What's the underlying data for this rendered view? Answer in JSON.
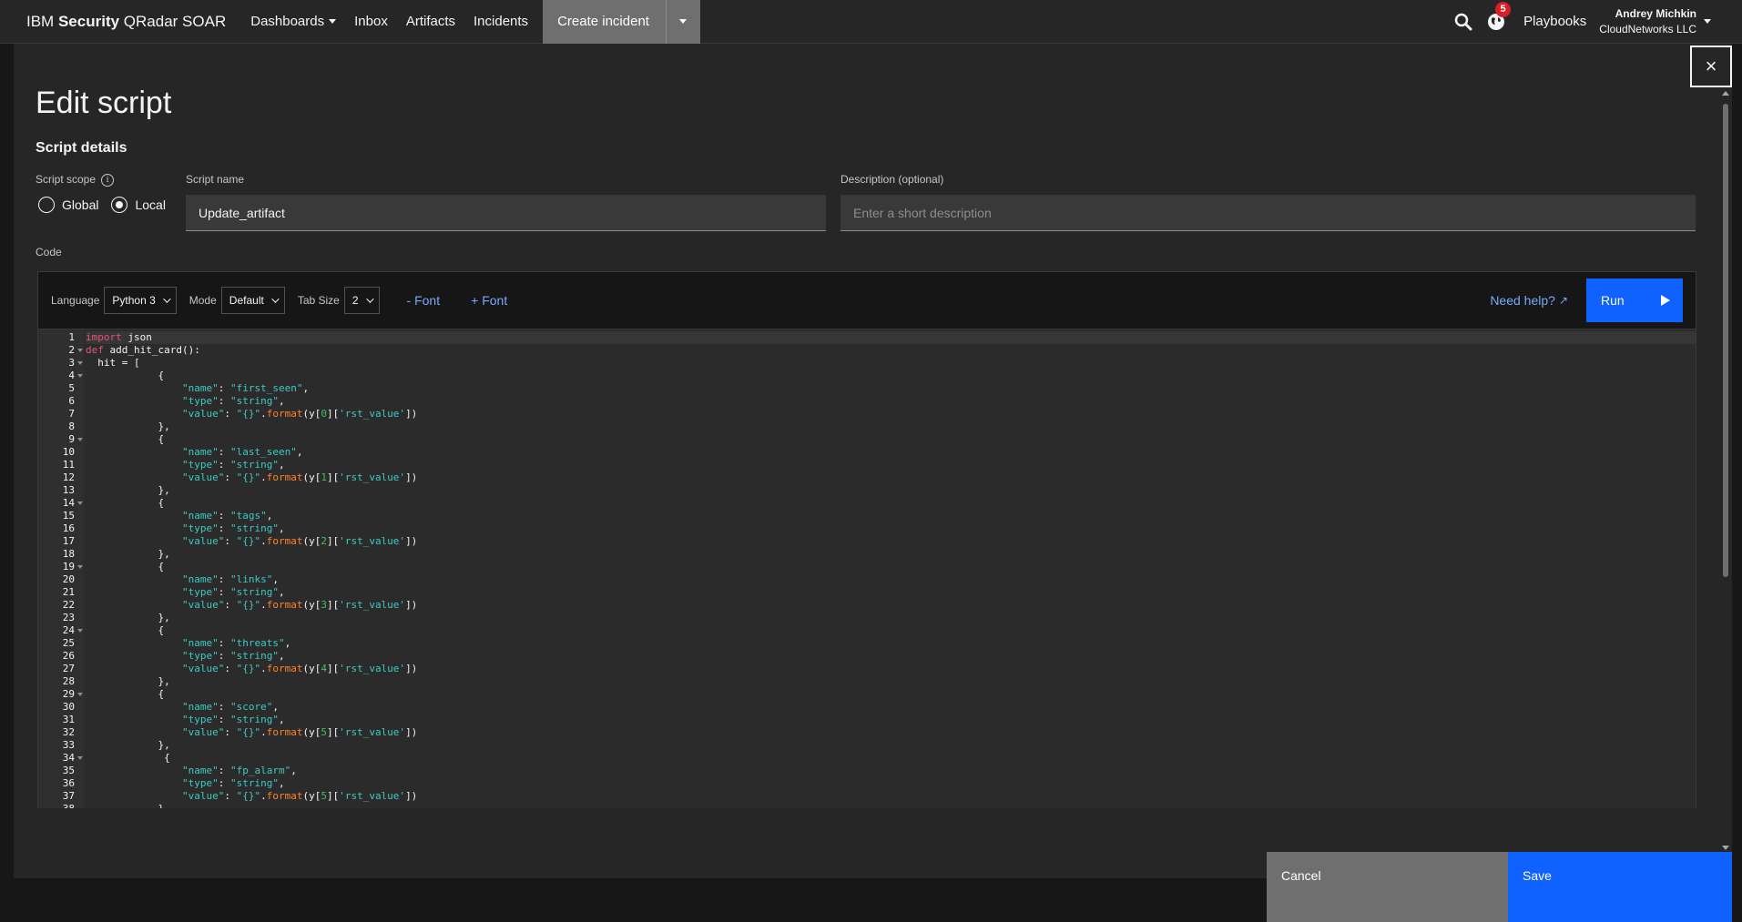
{
  "nav": {
    "brand_prefix": "IBM",
    "brand_bold": "Security",
    "brand_suffix": "QRadar SOAR",
    "items": [
      "Dashboards",
      "Inbox",
      "Artifacts",
      "Incidents"
    ],
    "create_label": "Create incident",
    "notification_count": "5",
    "playbooks_label": "Playbooks",
    "user_name": "Andrey Michkin",
    "org_name": "CloudNetworks LLC"
  },
  "modal": {
    "title": "Edit script",
    "section_title": "Script details",
    "close_label": "×"
  },
  "form": {
    "scope_label": "Script scope",
    "scope_options": [
      "Global",
      "Local"
    ],
    "scope_selected": "Local",
    "name_label": "Script name",
    "name_value": "Update_artifact",
    "description_label": "Description (optional)",
    "description_placeholder": "Enter a short description",
    "code_label": "Code"
  },
  "editor": {
    "language_label": "Language",
    "language_value": "Python 3",
    "mode_label": "Mode",
    "mode_value": "Default",
    "tab_size_label": "Tab Size",
    "tab_size_value": "2",
    "font_decrease": "- Font",
    "font_increase": "+ Font",
    "help_label": "Need help?",
    "run_label": "Run"
  },
  "code_lines": [
    [
      [
        "kw",
        "import"
      ],
      [
        "t",
        " json"
      ]
    ],
    [
      [
        "kw",
        "def"
      ],
      [
        "t",
        " add_hit_card():"
      ]
    ],
    [
      [
        "t",
        "  hit = ["
      ]
    ],
    [
      [
        "t",
        "            {"
      ]
    ],
    [
      [
        "t",
        "                "
      ],
      [
        "str",
        "\"name\""
      ],
      [
        "t",
        ": "
      ],
      [
        "str",
        "\"first_seen\""
      ],
      [
        "t",
        ","
      ]
    ],
    [
      [
        "t",
        "                "
      ],
      [
        "str",
        "\"type\""
      ],
      [
        "t",
        ": "
      ],
      [
        "str",
        "\"string\""
      ],
      [
        "t",
        ","
      ]
    ],
    [
      [
        "t",
        "                "
      ],
      [
        "str",
        "\"value\""
      ],
      [
        "t",
        ": "
      ],
      [
        "str",
        "\"{}\""
      ],
      [
        "t",
        "."
      ],
      [
        "fn",
        "format"
      ],
      [
        "t",
        "(y["
      ],
      [
        "num",
        "0"
      ],
      [
        "t",
        "]["
      ],
      [
        "str",
        "'rst_value'"
      ],
      [
        "t",
        "])"
      ]
    ],
    [
      [
        "t",
        "            },"
      ]
    ],
    [
      [
        "t",
        "            {"
      ]
    ],
    [
      [
        "t",
        "                "
      ],
      [
        "str",
        "\"name\""
      ],
      [
        "t",
        ": "
      ],
      [
        "str",
        "\"last_seen\""
      ],
      [
        "t",
        ","
      ]
    ],
    [
      [
        "t",
        "                "
      ],
      [
        "str",
        "\"type\""
      ],
      [
        "t",
        ": "
      ],
      [
        "str",
        "\"string\""
      ],
      [
        "t",
        ","
      ]
    ],
    [
      [
        "t",
        "                "
      ],
      [
        "str",
        "\"value\""
      ],
      [
        "t",
        ": "
      ],
      [
        "str",
        "\"{}\""
      ],
      [
        "t",
        "."
      ],
      [
        "fn",
        "format"
      ],
      [
        "t",
        "(y["
      ],
      [
        "num",
        "1"
      ],
      [
        "t",
        "]["
      ],
      [
        "str",
        "'rst_value'"
      ],
      [
        "t",
        "])"
      ]
    ],
    [
      [
        "t",
        "            },"
      ]
    ],
    [
      [
        "t",
        "            {"
      ]
    ],
    [
      [
        "t",
        "                "
      ],
      [
        "str",
        "\"name\""
      ],
      [
        "t",
        ": "
      ],
      [
        "str",
        "\"tags\""
      ],
      [
        "t",
        ","
      ]
    ],
    [
      [
        "t",
        "                "
      ],
      [
        "str",
        "\"type\""
      ],
      [
        "t",
        ": "
      ],
      [
        "str",
        "\"string\""
      ],
      [
        "t",
        ","
      ]
    ],
    [
      [
        "t",
        "                "
      ],
      [
        "str",
        "\"value\""
      ],
      [
        "t",
        ": "
      ],
      [
        "str",
        "\"{}\""
      ],
      [
        "t",
        "."
      ],
      [
        "fn",
        "format"
      ],
      [
        "t",
        "(y["
      ],
      [
        "num",
        "2"
      ],
      [
        "t",
        "]["
      ],
      [
        "str",
        "'rst_value'"
      ],
      [
        "t",
        "])"
      ]
    ],
    [
      [
        "t",
        "            },"
      ]
    ],
    [
      [
        "t",
        "            {"
      ]
    ],
    [
      [
        "t",
        "                "
      ],
      [
        "str",
        "\"name\""
      ],
      [
        "t",
        ": "
      ],
      [
        "str",
        "\"links\""
      ],
      [
        "t",
        ","
      ]
    ],
    [
      [
        "t",
        "                "
      ],
      [
        "str",
        "\"type\""
      ],
      [
        "t",
        ": "
      ],
      [
        "str",
        "\"string\""
      ],
      [
        "t",
        ","
      ]
    ],
    [
      [
        "t",
        "                "
      ],
      [
        "str",
        "\"value\""
      ],
      [
        "t",
        ": "
      ],
      [
        "str",
        "\"{}\""
      ],
      [
        "t",
        "."
      ],
      [
        "fn",
        "format"
      ],
      [
        "t",
        "(y["
      ],
      [
        "num",
        "3"
      ],
      [
        "t",
        "]["
      ],
      [
        "str",
        "'rst_value'"
      ],
      [
        "t",
        "])"
      ]
    ],
    [
      [
        "t",
        "            },"
      ]
    ],
    [
      [
        "t",
        "            {"
      ]
    ],
    [
      [
        "t",
        "                "
      ],
      [
        "str",
        "\"name\""
      ],
      [
        "t",
        ": "
      ],
      [
        "str",
        "\"threats\""
      ],
      [
        "t",
        ","
      ]
    ],
    [
      [
        "t",
        "                "
      ],
      [
        "str",
        "\"type\""
      ],
      [
        "t",
        ": "
      ],
      [
        "str",
        "\"string\""
      ],
      [
        "t",
        ","
      ]
    ],
    [
      [
        "t",
        "                "
      ],
      [
        "str",
        "\"value\""
      ],
      [
        "t",
        ": "
      ],
      [
        "str",
        "\"{}\""
      ],
      [
        "t",
        "."
      ],
      [
        "fn",
        "format"
      ],
      [
        "t",
        "(y["
      ],
      [
        "num",
        "4"
      ],
      [
        "t",
        "]["
      ],
      [
        "str",
        "'rst_value'"
      ],
      [
        "t",
        "])"
      ]
    ],
    [
      [
        "t",
        "            },"
      ]
    ],
    [
      [
        "t",
        "            {"
      ]
    ],
    [
      [
        "t",
        "                "
      ],
      [
        "str",
        "\"name\""
      ],
      [
        "t",
        ": "
      ],
      [
        "str",
        "\"score\""
      ],
      [
        "t",
        ","
      ]
    ],
    [
      [
        "t",
        "                "
      ],
      [
        "str",
        "\"type\""
      ],
      [
        "t",
        ": "
      ],
      [
        "str",
        "\"string\""
      ],
      [
        "t",
        ","
      ]
    ],
    [
      [
        "t",
        "                "
      ],
      [
        "str",
        "\"value\""
      ],
      [
        "t",
        ": "
      ],
      [
        "str",
        "\"{}\""
      ],
      [
        "t",
        "."
      ],
      [
        "fn",
        "format"
      ],
      [
        "t",
        "(y["
      ],
      [
        "num",
        "5"
      ],
      [
        "t",
        "]["
      ],
      [
        "str",
        "'rst_value'"
      ],
      [
        "t",
        "])"
      ]
    ],
    [
      [
        "t",
        "            },"
      ]
    ],
    [
      [
        "t",
        "             {"
      ]
    ],
    [
      [
        "t",
        "                "
      ],
      [
        "str",
        "\"name\""
      ],
      [
        "t",
        ": "
      ],
      [
        "str",
        "\"fp_alarm\""
      ],
      [
        "t",
        ","
      ]
    ],
    [
      [
        "t",
        "                "
      ],
      [
        "str",
        "\"type\""
      ],
      [
        "t",
        ": "
      ],
      [
        "str",
        "\"string\""
      ],
      [
        "t",
        ","
      ]
    ],
    [
      [
        "t",
        "                "
      ],
      [
        "str",
        "\"value\""
      ],
      [
        "t",
        ": "
      ],
      [
        "str",
        "\"{}\""
      ],
      [
        "t",
        "."
      ],
      [
        "fn",
        "format"
      ],
      [
        "t",
        "(y["
      ],
      [
        "num",
        "5"
      ],
      [
        "t",
        "]["
      ],
      [
        "str",
        "'rst_value'"
      ],
      [
        "t",
        "])"
      ]
    ],
    [
      [
        "t",
        "            },"
      ]
    ]
  ],
  "fold_lines": [
    2,
    3,
    4,
    9,
    14,
    19,
    24,
    29,
    34
  ],
  "footer": {
    "cancel_label": "Cancel",
    "save_label": "Save"
  },
  "colors": {
    "primary": "#0f62fe",
    "link": "#78a9ff",
    "keyword": "#e2567b",
    "string": "#3fc9c2",
    "function": "#ff832b",
    "number": "#42be65"
  }
}
